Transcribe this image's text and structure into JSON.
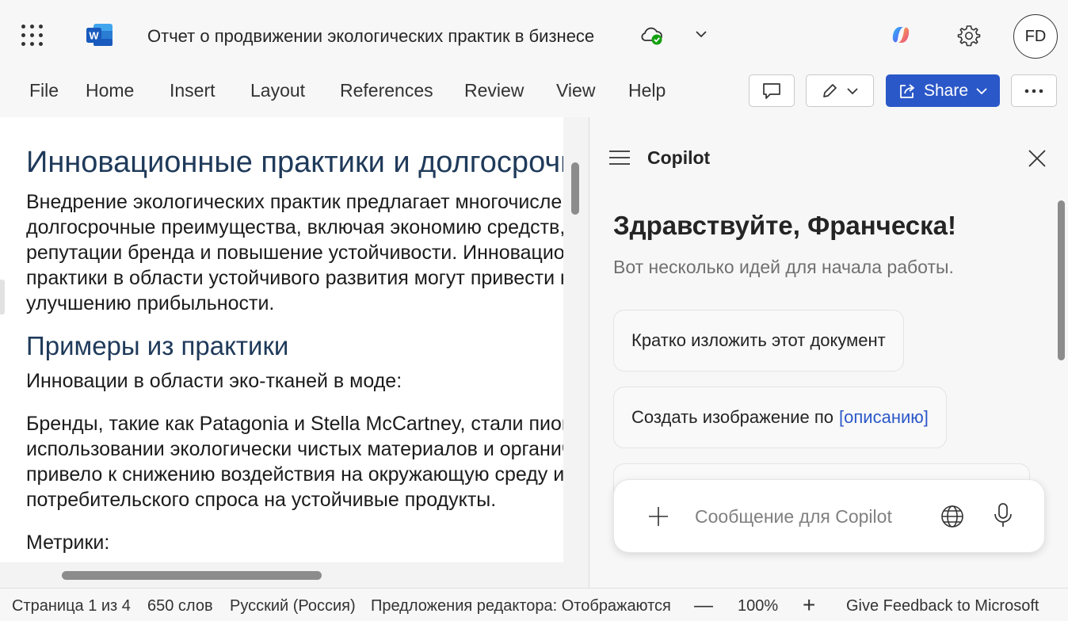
{
  "titlebar": {
    "app_icon": "word-icon",
    "app_letter": "W",
    "document_title": "Отчет о продвижении экологических практик в бизнесе",
    "status_icon": "cloud-saved-icon",
    "avatar_initials": "FD"
  },
  "menu": {
    "items": [
      "File",
      "Home",
      "Insert",
      "Layout",
      "References",
      "Review",
      "View",
      "Help"
    ],
    "share_label": "Share"
  },
  "document": {
    "heading1": "Инновационные практики и долгосрочные",
    "paragraph1": [
      "Внедрение экологических практик предлагает многочисленные",
      "долгосрочные преимущества, включая экономию средств, улучшение",
      "репутации бренда и повышение устойчивости. Инновационные",
      "практики в области устойчивого развития могут привести к",
      "улучшению прибыльности."
    ],
    "heading2": "Примеры из практики",
    "subhead": "Инновации в области эко-тканей в моде:",
    "paragraph2": [
      "Бренды, такие как Patagonia и Stella McCartney, стали пионерами в",
      "использовании экологически чистых материалов и органических тканей, что",
      "привело к снижению воздействия на окружающую среду и увеличению",
      "потребительского спроса на устойчивые продукты."
    ],
    "metrics_label": "Метрики:"
  },
  "copilot": {
    "title": "Copilot",
    "greeting": "Здравствуйте, Франческа!",
    "subtitle": "Вот несколько идей для начала работы.",
    "suggestion1": "Кратко изложить этот документ",
    "suggestion2_text": "Создать изображение по",
    "suggestion2_link": "[описанию]",
    "composer_placeholder": "Сообщение для Copilot"
  },
  "statusbar": {
    "page": "Страница 1 из 4",
    "words": "650 слов",
    "language": "Русский (Россия)",
    "editor": "Предложения редактора: Отображаются",
    "zoom_out": "—",
    "zoom": "100%",
    "zoom_in": "+",
    "feedback": "Give Feedback to Microsoft"
  },
  "colors": {
    "accent": "#2b58c8",
    "heading": "#1f3a5a",
    "word_blue": "#185abd"
  }
}
